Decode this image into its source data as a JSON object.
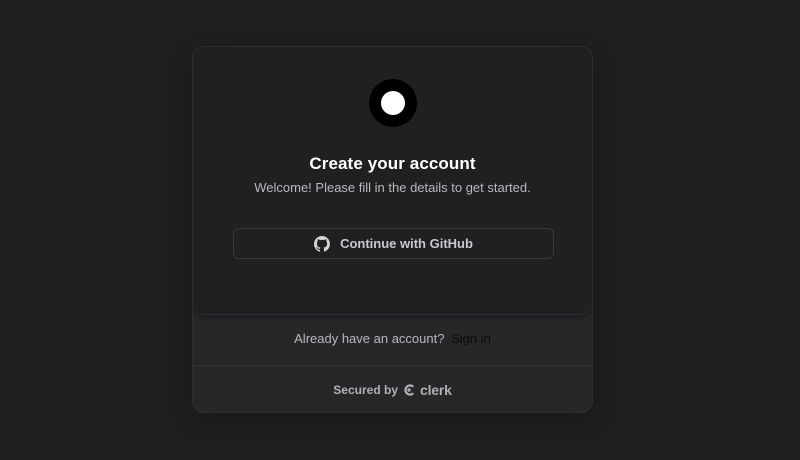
{
  "card": {
    "title": "Create your account",
    "subtitle": "Welcome! Please fill in the details to get started.",
    "logo_icon": "circle-logo-icon"
  },
  "github_button": {
    "label": "Continue with GitHub",
    "icon": "github-icon"
  },
  "footer": {
    "signin_prompt": "Already have an account?",
    "signin_link": "Sign in",
    "secured_by": "Secured by",
    "brand": "clerk",
    "brand_icon": "clerk-logo-icon"
  },
  "colors": {
    "page_background": "#1f1f22",
    "card_background": "#202023",
    "footer_background": "#27272a",
    "title": "#ffffff",
    "text_muted": "#b8b8bd",
    "signin_link": "#0b0b0c"
  }
}
